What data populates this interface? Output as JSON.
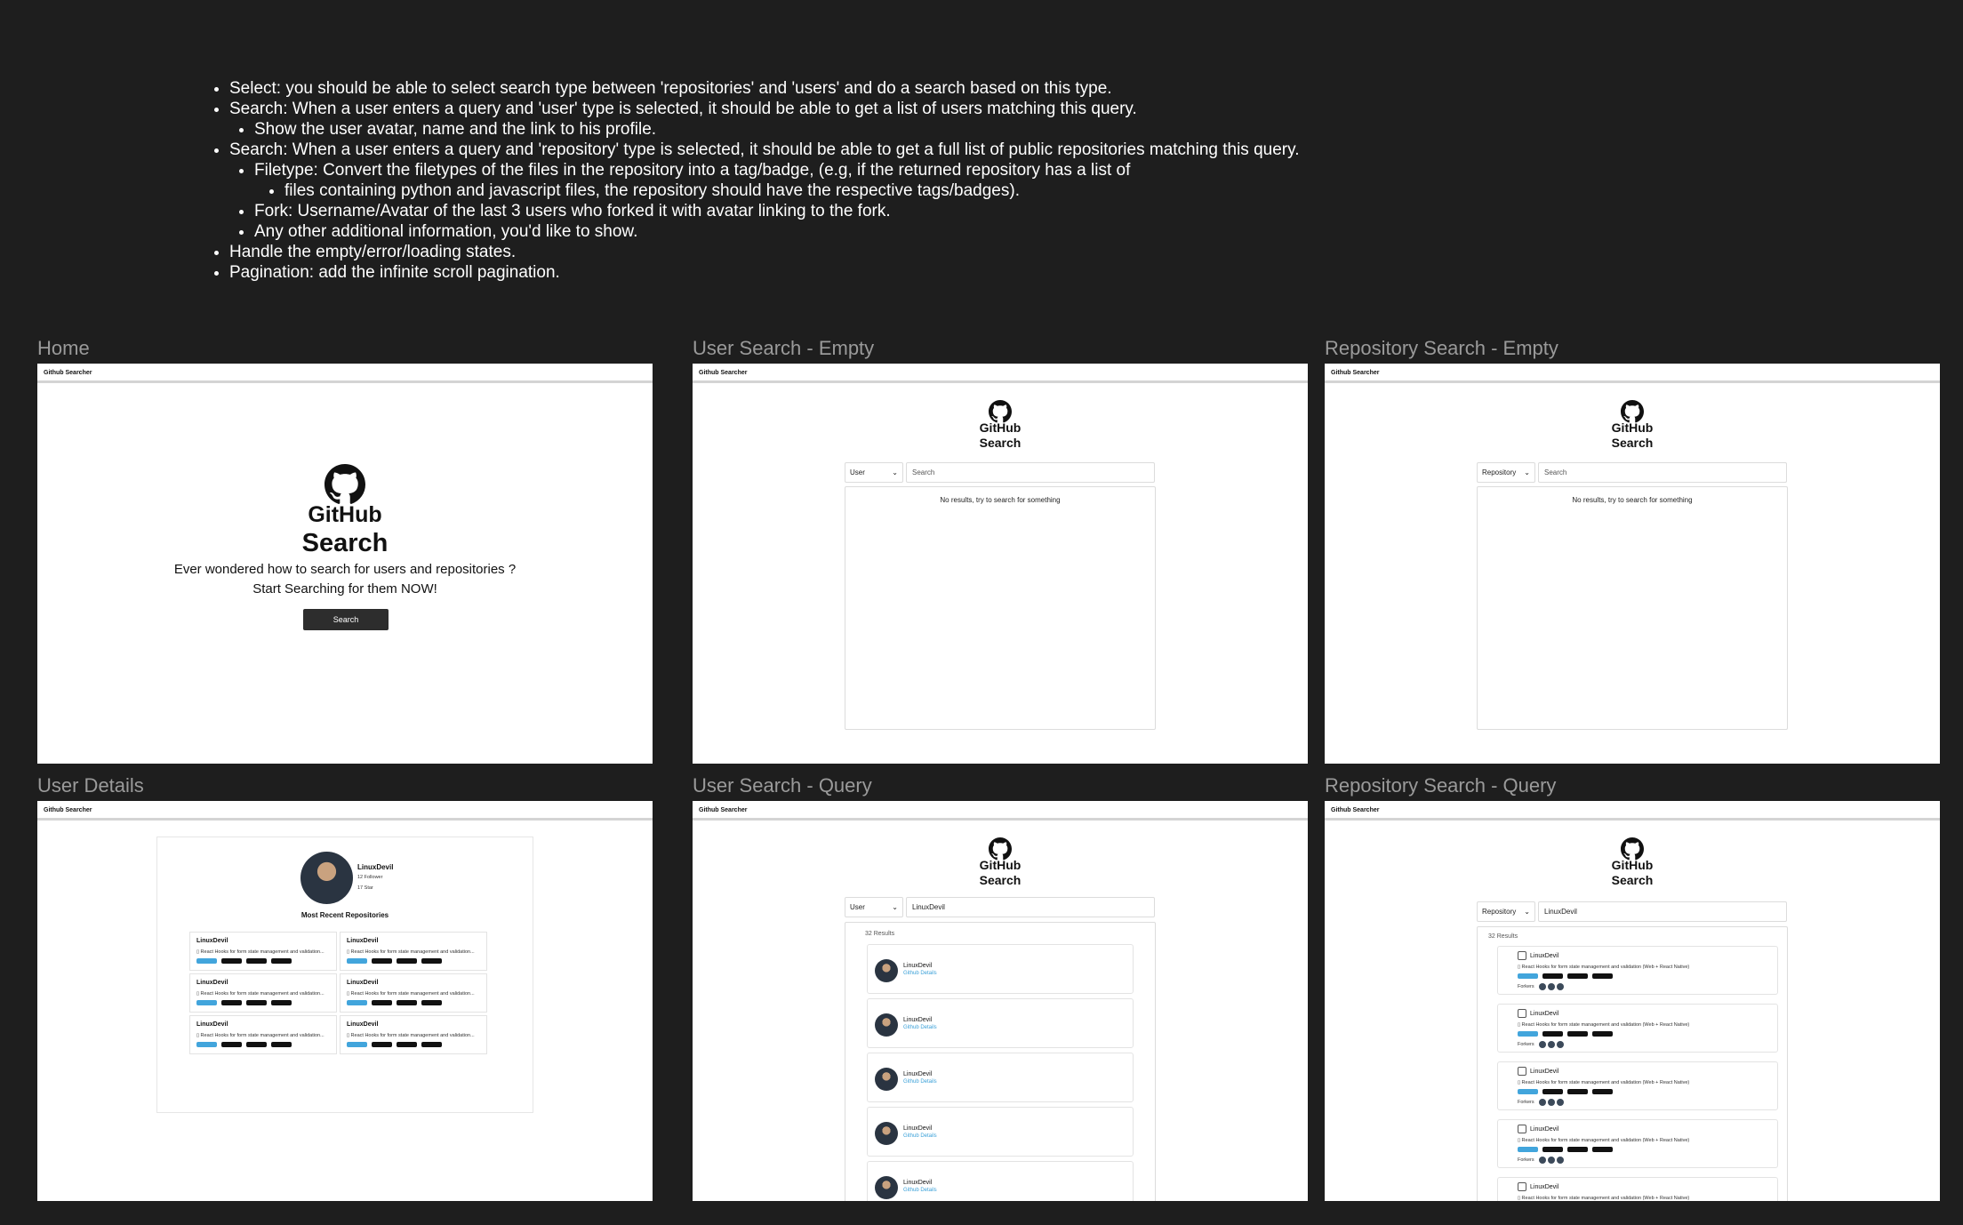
{
  "requirements": [
    {
      "text": "Select: you should be able to select search type between 'repositories' and 'users' and do a search based on this type."
    },
    {
      "text": "Search: When a user enters a query and 'user' type is selected, it should be able to get a list of users matching this query.",
      "sub": [
        {
          "text": "Show the user avatar, name and the link to his profile."
        }
      ]
    },
    {
      "text": "Search: When a user enters a query and 'repository' type is selected, it should be able to get a full list of public repositories matching this query.",
      "sub": [
        {
          "text": "Filetype: Convert the filetypes of the files in the repository into a tag/badge, (e.g, if the returned repository has a list of",
          "sub": [
            {
              "text": "files containing python and javascript files, the repository should have the respective tags/badges)."
            }
          ]
        },
        {
          "text": "Fork: Username/Avatar of the last 3 users who forked it with avatar linking to the fork."
        },
        {
          "text": "Any other additional information, you'd like to show."
        }
      ]
    },
    {
      "text": "Handle the empty/error/loading states."
    },
    {
      "text": "Pagination: add the infinite scroll pagination."
    }
  ],
  "frames": {
    "home": {
      "label": "Home"
    },
    "user_empty": {
      "label": "User Search - Empty"
    },
    "repo_empty": {
      "label": "Repository Search - Empty"
    },
    "user_details": {
      "label": "User Details"
    },
    "user_query": {
      "label": "User Search - Query"
    },
    "repo_query": {
      "label": "Repository Search - Query"
    }
  },
  "app": {
    "title": "Github Searcher",
    "logo_text": "GitHub",
    "search_title": "Search",
    "search_placeholder": "Search",
    "no_results": "No results, try to search for something"
  },
  "home": {
    "tagline1": "Ever wondered how to search for users and repositories ?",
    "tagline2": "Start Searching for them NOW!",
    "search_button": "Search"
  },
  "user_empty": {
    "type": "User"
  },
  "repo_empty": {
    "type": "Repository"
  },
  "user_query": {
    "type": "User",
    "query": "LinuxDevil",
    "count": "32 Results",
    "users": [
      {
        "name": "LinuxDevil",
        "link": "Github Details"
      },
      {
        "name": "LinuxDevil",
        "link": "Github Details"
      },
      {
        "name": "LinuxDevil",
        "link": "Github Details"
      },
      {
        "name": "LinuxDevil",
        "link": "Github Details"
      },
      {
        "name": "LinuxDevil",
        "link": "Github Details"
      }
    ]
  },
  "repo_query": {
    "type": "Repository",
    "query": "LinuxDevil",
    "count": "32 Results",
    "forkers_label": "Forkers",
    "repos": [
      {
        "name": "LinuxDevil",
        "desc": "React Hooks for form state management and validation (Web + React Native)"
      },
      {
        "name": "LinuxDevil",
        "desc": "React Hooks for form state management and validation (Web + React Native)"
      },
      {
        "name": "LinuxDevil",
        "desc": "React Hooks for form state management and validation (Web + React Native)"
      },
      {
        "name": "LinuxDevil",
        "desc": "React Hooks for form state management and validation (Web + React Native)"
      },
      {
        "name": "LinuxDevil",
        "desc": "React Hooks for form state management and validation (Web + React Native)"
      }
    ]
  },
  "user_details": {
    "name": "LinuxDevil",
    "followers": "12 Follower",
    "stars": "17 Star",
    "section_title": "Most Recent Repositories",
    "repos": [
      {
        "name": "LinuxDevil",
        "desc": "React Hooks for form state management and validation..."
      },
      {
        "name": "LinuxDevil",
        "desc": "React Hooks for form state management and validation..."
      },
      {
        "name": "LinuxDevil",
        "desc": "React Hooks for form state management and validation..."
      },
      {
        "name": "LinuxDevil",
        "desc": "React Hooks for form state management and validation..."
      },
      {
        "name": "LinuxDevil",
        "desc": "React Hooks for form state management and validation..."
      },
      {
        "name": "LinuxDevil",
        "desc": "React Hooks for form state management and validation..."
      }
    ]
  },
  "colors": {
    "canvas": "#1e1e1e",
    "badge_blue": "#42a5dc",
    "link_blue": "#3aa0d8",
    "button": "#2d2d2d"
  }
}
